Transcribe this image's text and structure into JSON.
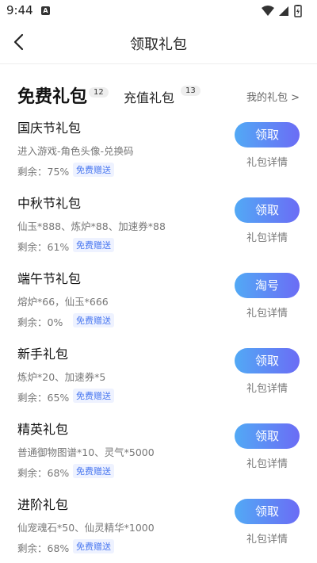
{
  "status_bar": {
    "time": "9:44",
    "notif_letter": "A"
  },
  "nav": {
    "title": "领取礼包"
  },
  "tabs": [
    {
      "label": "免费礼包",
      "count": "12",
      "active": true
    },
    {
      "label": "充值礼包",
      "count": "13",
      "active": false
    }
  ],
  "my_gifts_label": "我的礼包 >",
  "gifts": [
    {
      "name": "国庆节礼包",
      "desc": "进入游戏-角色头像-兑换码",
      "remain": "剩余：75%",
      "badge": "免费赠送",
      "action": "领取",
      "detail": "礼包详情"
    },
    {
      "name": "中秋节礼包",
      "desc": "仙玉*888、炼炉*88、加速券*88",
      "remain": "剩余：61%",
      "badge": "免费赠送",
      "action": "领取",
      "detail": "礼包详情"
    },
    {
      "name": "端午节礼包",
      "desc": "熔炉*66，仙玉*666",
      "remain": "剩余：0%",
      "badge": "免费赠送",
      "action": "淘号",
      "detail": "礼包详情"
    },
    {
      "name": "新手礼包",
      "desc": "炼炉*20、加速券*5",
      "remain": "剩余：65%",
      "badge": "免费赠送",
      "action": "领取",
      "detail": "礼包详情"
    },
    {
      "name": "精英礼包",
      "desc": "普通御物图谱*10、灵气*5000",
      "remain": "剩余：68%",
      "badge": "免费赠送",
      "action": "领取",
      "detail": "礼包详情"
    },
    {
      "name": "进阶礼包",
      "desc": "仙宠魂石*50、仙灵精华*1000",
      "remain": "剩余：68%",
      "badge": "免费赠送",
      "action": "领取",
      "detail": "礼包详情"
    }
  ],
  "colors": {
    "accent_start": "#52a9f5",
    "accent_end": "#6b6cf5",
    "badge_text": "#4a78f0"
  }
}
